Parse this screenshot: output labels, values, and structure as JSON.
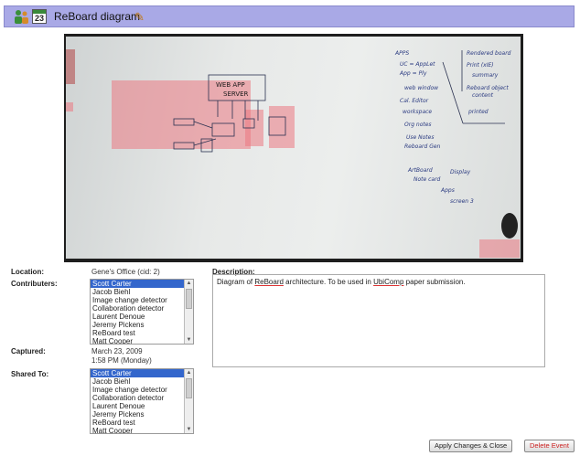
{
  "header": {
    "calendar_day": "23",
    "title": "ReBoard diagram"
  },
  "fields": {
    "location_label": "Location:",
    "location_value": "Gene's Office (cid: 2)",
    "contributers_label": "Contributers:",
    "captured_label": "Captured:",
    "captured_date": "March 23, 2009",
    "captured_time": "1:58 PM (Monday)",
    "shared_label": "Shared To:",
    "description_label": "Description:",
    "description_pre": "Diagram of ",
    "description_rb": "ReBoard",
    "description_mid": " architecture.  To be used in ",
    "description_uc": "UbiComp",
    "description_post": " paper submission."
  },
  "contributers": [
    "Scott Carter",
    "Jacob Biehl",
    "Image change detector",
    "Collaboration detector",
    "Laurent Denoue",
    "Jeremy Pickens",
    "ReBoard test",
    "Matt Cooper"
  ],
  "shared_to": [
    "Scott Carter",
    "Jacob Biehl",
    "Image change detector",
    "Collaboration detector",
    "Laurent Denoue",
    "Jeremy Pickens",
    "ReBoard test",
    "Matt Cooper"
  ],
  "buttons": {
    "apply": "Apply Changes & Close",
    "delete": "Delete Event"
  },
  "whiteboard": {
    "box_text_1": "WEB APP",
    "box_text_2": "SERVER"
  },
  "colors": {
    "titlebar": "#a9a9e6",
    "selection": "#3366cc",
    "highlight": "#eb7882",
    "delete": "#cc2222"
  }
}
